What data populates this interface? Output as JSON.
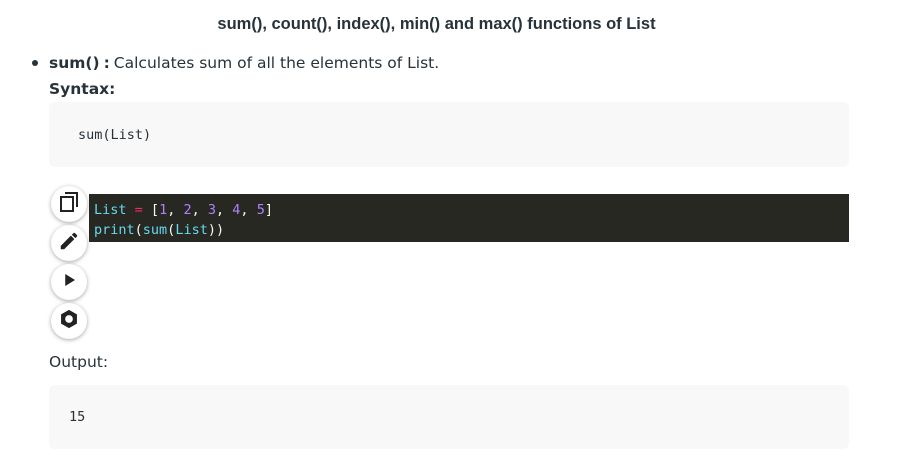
{
  "article": {
    "title": "sum(), count(), index(), min() and max() functions of List",
    "bullet": {
      "term": "sum()",
      "separator": ":",
      "description": "Calculates sum of all the elements of List."
    },
    "syntax_label": "Syntax:",
    "syntax_code": "sum(List)"
  },
  "toolbar": {
    "icons": [
      "copy-icon",
      "edit-icon",
      "run-icon",
      "settings-icon"
    ]
  },
  "code": {
    "lines": [
      [
        {
          "t": "List",
          "k": "name"
        },
        {
          "t": " ",
          "k": "punc"
        },
        {
          "t": "=",
          "k": "op"
        },
        {
          "t": " [",
          "k": "punc"
        },
        {
          "t": "1",
          "k": "num"
        },
        {
          "t": ", ",
          "k": "punc"
        },
        {
          "t": "2",
          "k": "num"
        },
        {
          "t": ", ",
          "k": "punc"
        },
        {
          "t": "3",
          "k": "num"
        },
        {
          "t": ", ",
          "k": "punc"
        },
        {
          "t": "4",
          "k": "num"
        },
        {
          "t": ", ",
          "k": "punc"
        },
        {
          "t": "5",
          "k": "num"
        },
        {
          "t": "]",
          "k": "punc"
        }
      ],
      [
        {
          "t": "print",
          "k": "name"
        },
        {
          "t": "(",
          "k": "punc"
        },
        {
          "t": "sum",
          "k": "name"
        },
        {
          "t": "(",
          "k": "punc"
        },
        {
          "t": "List",
          "k": "name"
        },
        {
          "t": "))",
          "k": "punc"
        }
      ]
    ]
  },
  "output": {
    "label": "Output:",
    "value": "15"
  },
  "colors": {
    "text": "#273239",
    "code_bg": "#272822",
    "code_name": "#66d9ef",
    "code_op": "#f92672",
    "code_num": "#ae81ff",
    "code_punc": "#f8f8f2",
    "box_bg": "#f8f8f8"
  }
}
